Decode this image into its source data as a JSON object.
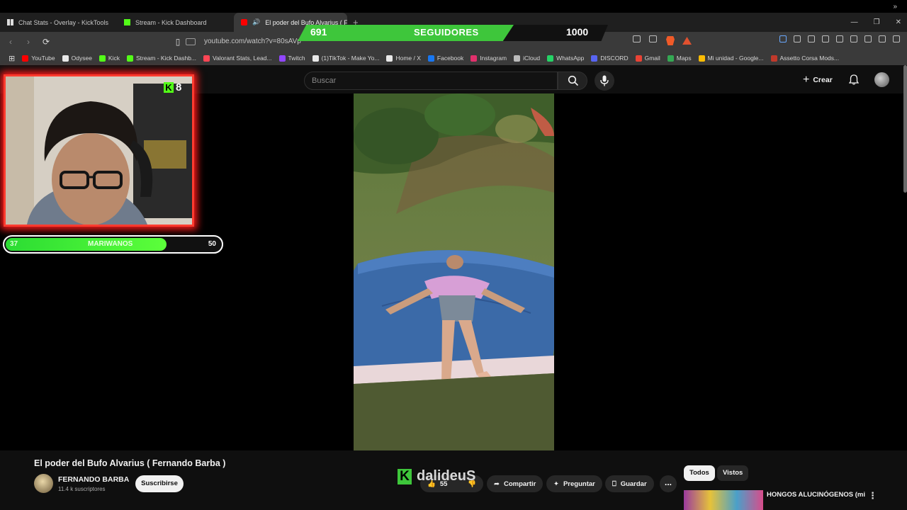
{
  "browser": {
    "tabs": [
      {
        "label": "Chat Stats - Overlay - KickTools",
        "active": false
      },
      {
        "label": "Stream - Kick Dashboard",
        "active": false
      },
      {
        "label": "El poder del Bufo Alvarius ( F",
        "active": true
      }
    ],
    "new_tab": "+",
    "url": "youtube.com/watch?v=80sAVp",
    "bookmarks": [
      "YouTube",
      "Odysee",
      "Kick",
      "Stream - Kick Dashb...",
      "Valorant Stats, Lead...",
      "Twitch",
      "(1)TikTok - Make Yo...",
      "Home / X",
      "Facebook",
      "Instagram",
      "iCloud",
      "WhatsApp",
      "DISCORD",
      "Gmail",
      "Maps",
      "Mi unidad - Google...",
      "Assetto Corsa Mods..."
    ],
    "bookmark_colors": [
      "#ff0000",
      "#e8e8e8",
      "#53fc18",
      "#53fc18",
      "#ff4655",
      "#9146ff",
      "#e8e8e8",
      "#e8e8e8",
      "#1877f2",
      "#e1306c",
      "#bbbbbb",
      "#25d366",
      "#5865f2",
      "#ea4335",
      "#34a853",
      "#fbbc04",
      "#c0392b"
    ]
  },
  "overlay": {
    "followers": {
      "current": "691",
      "label": "SEGUIDORES",
      "goal": "1000",
      "progress": 0.691
    },
    "kick_viewers": "8",
    "sub_goal": {
      "current": "37",
      "label": "MARIWANOS",
      "max": "50",
      "progress": 0.74
    }
  },
  "youtube": {
    "search_placeholder": "Buscar",
    "create_label": "Crear",
    "video": {
      "title": "El poder del Bufo Alvarius ( Fernando Barba )",
      "channel": "FERNANDO BARBA",
      "subscribers": "11.4 k suscriptores",
      "subscribe_label": "Suscribirse",
      "likes": "55",
      "actions": {
        "share": "Compartir",
        "ask": "Preguntar",
        "save": "Guardar"
      },
      "more": "..."
    },
    "watermark": "dalideuS",
    "chips": {
      "all": "Todos",
      "watched": "Vistos"
    },
    "recommendation": {
      "title": "HONGOS ALUCINÓGENOS (mi"
    }
  }
}
